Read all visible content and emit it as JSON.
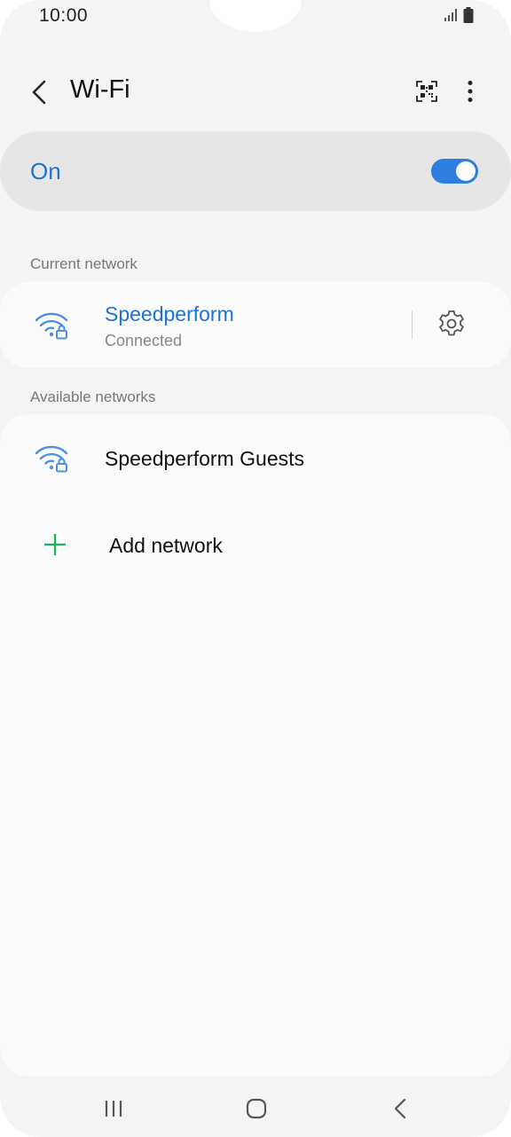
{
  "status_bar": {
    "time": "10:00",
    "signal_icon": "signal-bars-icon",
    "battery_icon": "battery-icon"
  },
  "header": {
    "title": "Wi-Fi",
    "back_icon": "back-arrow-icon",
    "qr_icon": "qr-code-scan-icon",
    "more_icon": "more-options-icon"
  },
  "wifi_toggle": {
    "label": "On",
    "state": "on",
    "accent_color": "#2f7fe0"
  },
  "current_network": {
    "section_label": "Current network",
    "name": "Speedperform",
    "status": "Connected",
    "icon": "wifi-lock-icon",
    "settings_icon": "gear-icon",
    "name_color": "#1b73d2"
  },
  "available_networks": {
    "section_label": "Available networks",
    "items": [
      {
        "name": "Speedperform Guests",
        "icon": "wifi-lock-icon"
      }
    ],
    "add_network": {
      "label": "Add network",
      "icon": "plus-icon",
      "icon_color": "#1fb35a"
    }
  },
  "nav_bar": {
    "recents_icon": "recent-apps-icon",
    "home_icon": "home-icon",
    "back_icon": "back-icon"
  }
}
